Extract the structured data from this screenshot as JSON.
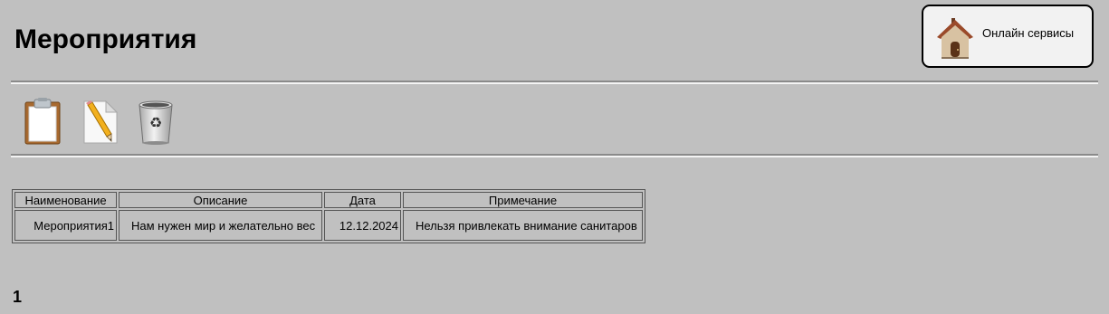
{
  "page": {
    "title": "Мероприятия"
  },
  "online_services": {
    "label": "Онлайн сервисы",
    "icon": "house-icon"
  },
  "toolbar": {
    "add_icon": "clipboard-icon",
    "edit_icon": "pencil-document-icon",
    "delete_icon": "recycle-bin-icon"
  },
  "table": {
    "columns": [
      "Наименование",
      "Описание",
      "Дата",
      "Примечание"
    ],
    "rows": [
      {
        "name": "Мероприятия1",
        "description": "Нам нужен мир и желательно вес",
        "date": "12.12.2024",
        "note": "Нельзя привлекать внимание санитаров"
      }
    ]
  },
  "pagination": {
    "current_page": "1"
  }
}
